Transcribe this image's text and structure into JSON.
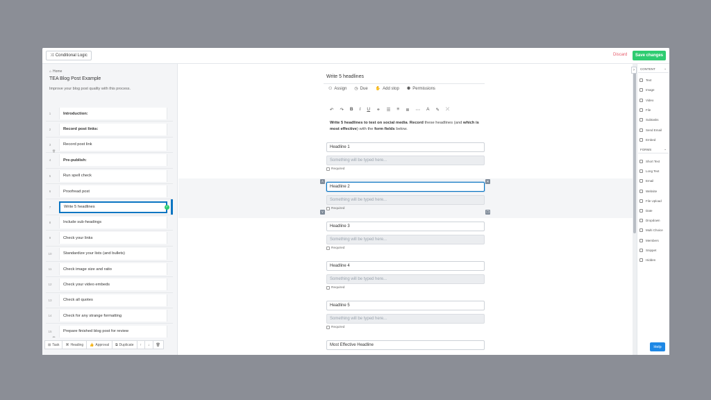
{
  "topbar": {
    "conditional_logic": "Conditional Logic",
    "discard": "Discard",
    "save": "Save changes"
  },
  "left": {
    "home": "Home",
    "title": "TEA Blog Post Example",
    "description": "Improve your blog post quality with this process.",
    "tasks": [
      {
        "num": "1",
        "label": "Introduction:",
        "heading": true
      },
      {
        "num": "2",
        "label": "Record post links:",
        "heading": true
      },
      {
        "num": "3",
        "label": "Record post link",
        "heading": false
      },
      {
        "num": "4",
        "label": "Pre-publish:",
        "heading": true
      },
      {
        "num": "5",
        "label": "Run spell check",
        "heading": false
      },
      {
        "num": "6",
        "label": "Proofread post",
        "heading": false
      },
      {
        "num": "7",
        "label": "Write 5 headlines",
        "heading": false,
        "active": true
      },
      {
        "num": "8",
        "label": "Include sub-headings",
        "heading": false
      },
      {
        "num": "9",
        "label": "Check your links",
        "heading": false
      },
      {
        "num": "10",
        "label": "Standardize your lists (and bullets)",
        "heading": false
      },
      {
        "num": "11",
        "label": "Check image size and ratio",
        "heading": false
      },
      {
        "num": "12",
        "label": "Check your video embeds",
        "heading": false
      },
      {
        "num": "13",
        "label": "Check all quotes",
        "heading": false
      },
      {
        "num": "14",
        "label": "Check for any strange formatting",
        "heading": false
      },
      {
        "num": "15",
        "label": "Prepare finished blog post for review",
        "heading": false
      }
    ],
    "bottom_tools": [
      "Task",
      "Heading",
      "Approval",
      "Duplicate"
    ]
  },
  "editor": {
    "title": "Write 5 headlines",
    "actions": [
      "Assign",
      "Due",
      "Add stop",
      "Permissions"
    ],
    "instructions": {
      "p1_bold": "Write 5 headlines to test on social media",
      "p2": ". ",
      "p3_bold": "Record",
      "p4": " these headlines (and ",
      "p5_bold": "which is most effective",
      "p6": ") with the ",
      "p7_bold": "form fields",
      "p8": " below."
    },
    "placeholder": "Something will be typed here...",
    "required": "Required",
    "fields": [
      "Headline 1",
      "Headline 2",
      "Headline 3",
      "Headline 4",
      "Headline 5",
      "Most Effective Headline"
    ]
  },
  "right": {
    "content_label": "CONTENT",
    "content_items": [
      "Text",
      "Image",
      "Video",
      "File",
      "Subtasks",
      "Send Email",
      "Embed"
    ],
    "forms_label": "FORMS",
    "form_items": [
      "Short Text",
      "Long Text",
      "Email",
      "Website",
      "File Upload",
      "Date",
      "Dropdown",
      "Multi Choice",
      "Members",
      "Snippet",
      "Hidden"
    ],
    "help": "Help"
  }
}
